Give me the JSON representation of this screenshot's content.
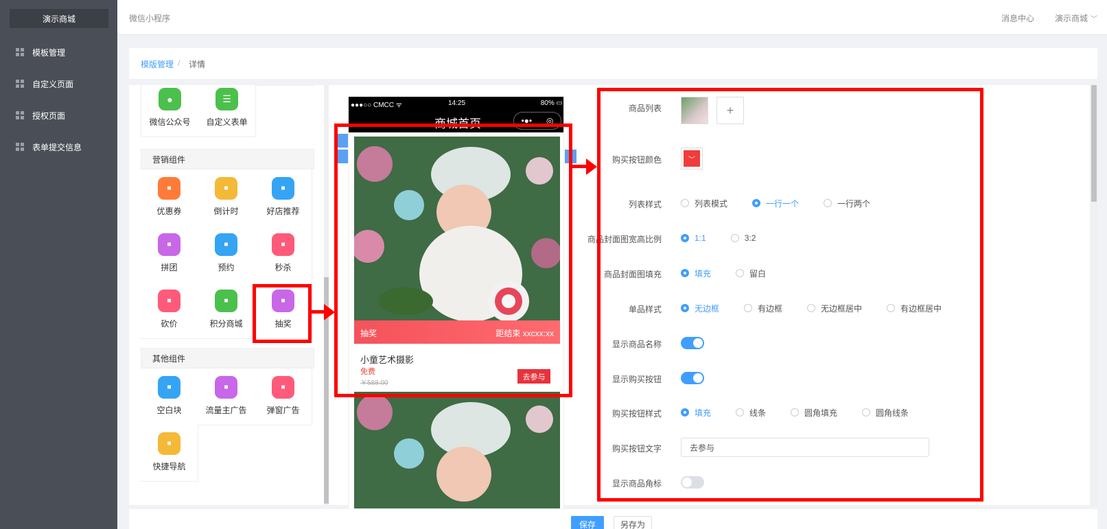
{
  "sidebar": {
    "brand": "演示商城",
    "items": [
      {
        "label": "模板管理"
      },
      {
        "label": "自定义页面"
      },
      {
        "label": "授权页面"
      },
      {
        "label": "表单提交信息"
      }
    ]
  },
  "header": {
    "title": "微信小程序",
    "message_center": "消息中心",
    "user": "演示商城"
  },
  "breadcrumb": {
    "link": "模版管理",
    "separator": "/",
    "current": "详情"
  },
  "components": {
    "top_row": [
      {
        "label": "微信公众号",
        "color": "#4cc04c",
        "icon": "wechat-icon"
      },
      {
        "label": "自定义表单",
        "color": "#4cc04c",
        "icon": "form-icon"
      }
    ],
    "marketing_title": "营销组件",
    "marketing": [
      {
        "label": "优惠券",
        "color": "#ff7b39",
        "icon": "coupon-icon"
      },
      {
        "label": "倒计时",
        "color": "#f5b938",
        "icon": "hourglass-icon"
      },
      {
        "label": "好店推荐",
        "color": "#35a4f4",
        "icon": "store-icon"
      },
      {
        "label": "拼团",
        "color": "#c867e8",
        "icon": "group-icon"
      },
      {
        "label": "预约",
        "color": "#35a4f4",
        "icon": "calendar-icon"
      },
      {
        "label": "秒杀",
        "color": "#ff5a7a",
        "icon": "alarm-icon"
      },
      {
        "label": "砍价",
        "color": "#ff5a7a",
        "icon": "yuan-icon"
      },
      {
        "label": "积分商城",
        "color": "#4cc04c",
        "icon": "coins-icon"
      },
      {
        "label": "抽奖",
        "color": "#c867e8",
        "icon": "gift-icon"
      }
    ],
    "other_title": "其他组件",
    "other": [
      {
        "label": "空白块",
        "color": "#35a4f4",
        "icon": "blank-icon"
      },
      {
        "label": "流量主广告",
        "color": "#c867e8",
        "icon": "ad-icon"
      },
      {
        "label": "弹窗广告",
        "color": "#ff5a7a",
        "icon": "popup-icon"
      },
      {
        "label": "快捷导航",
        "color": "#f5b938",
        "icon": "compass-icon"
      }
    ]
  },
  "phone": {
    "carrier": "●●●○○ CMCC ᯤ",
    "time": "14:25",
    "battery": "80%",
    "page_title": "商城首页",
    "capsule_menu": "•●•",
    "banner_left": "抽奖",
    "banner_right": "距结束 xxcxx:xx",
    "product_name": "小童艺术摄影",
    "price": "免费",
    "old_price": "￥588.00",
    "join_button": "去参与"
  },
  "settings": {
    "product_list_label": "商品列表",
    "buy_color_label": "购买按钮颜色",
    "buy_color": "#f03c3c",
    "list_style_label": "列表样式",
    "list_style_options": [
      "列表模式",
      "一行一个",
      "一行两个"
    ],
    "list_style_selected": "一行一个",
    "ratio_label": "商品封面图宽高比例",
    "ratio_options": [
      "1:1",
      "3:2"
    ],
    "ratio_selected": "1:1",
    "fill_label": "商品封面图填充",
    "fill_options": [
      "填充",
      "留白"
    ],
    "fill_selected": "填充",
    "single_style_label": "单品样式",
    "single_style_options": [
      "无边框",
      "有边框",
      "无边框居中",
      "有边框居中"
    ],
    "single_style_selected": "无边框",
    "show_name_label": "显示商品名称",
    "show_name": true,
    "show_buy_label": "显示购买按钮",
    "show_buy": true,
    "buy_btn_style_label": "购买按钮样式",
    "buy_btn_style_options": [
      "填充",
      "线条",
      "圆角填充",
      "圆角线条"
    ],
    "buy_btn_style_selected": "填充",
    "buy_btn_text_label": "购买按钮文字",
    "buy_btn_text": "去参与",
    "show_corner_label": "显示商品角标",
    "show_corner": false
  },
  "footer": {
    "save": "保存",
    "save_as": "另存为"
  }
}
